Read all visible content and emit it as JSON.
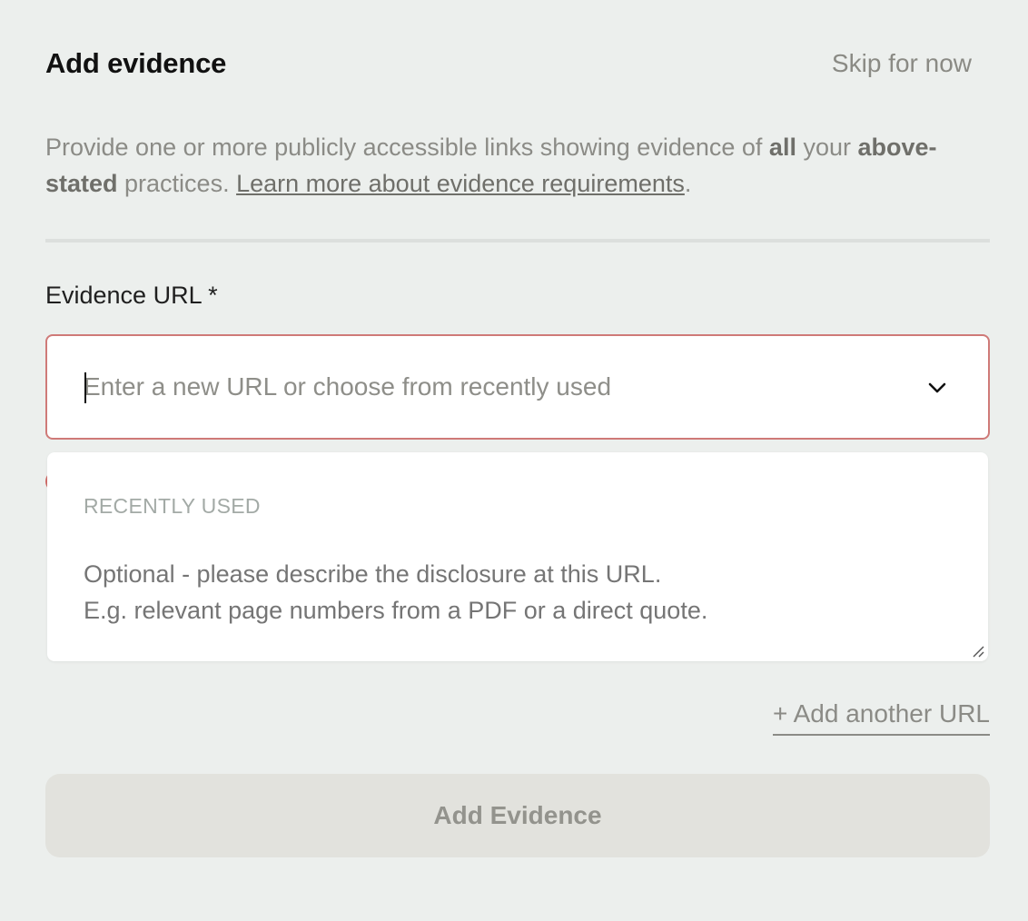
{
  "header": {
    "title": "Add evidence",
    "skip_label": "Skip for now"
  },
  "description": {
    "part1": "Provide one or more publicly accessible links showing evidence of ",
    "bold1": "all",
    "part2": " your ",
    "bold2": "above-stated",
    "part3": " practices. ",
    "link_text": "Learn more about evidence requirements",
    "part4": "."
  },
  "field": {
    "label": "Evidence URL *",
    "placeholder": "Enter a new URL or choose from recently used",
    "value": ""
  },
  "dropdown": {
    "heading": "RECENTLY USED"
  },
  "disclosure": {
    "placeholder": "Optional - please describe the disclosure at this URL.\nE.g. relevant page numbers from a PDF or a direct quote."
  },
  "actions": {
    "add_url_label": "+ Add another URL",
    "submit_label": "Add Evidence"
  },
  "icons": {
    "dropdown": "chevron-down-icon",
    "resize": "resize-grip-icon"
  },
  "colors": {
    "background": "#ecefed",
    "error_border": "#cf7a78",
    "error_dot": "#cf6a66",
    "button_bg": "#e2e2dd",
    "button_text": "#93938d",
    "muted_text": "#8b8b86"
  }
}
